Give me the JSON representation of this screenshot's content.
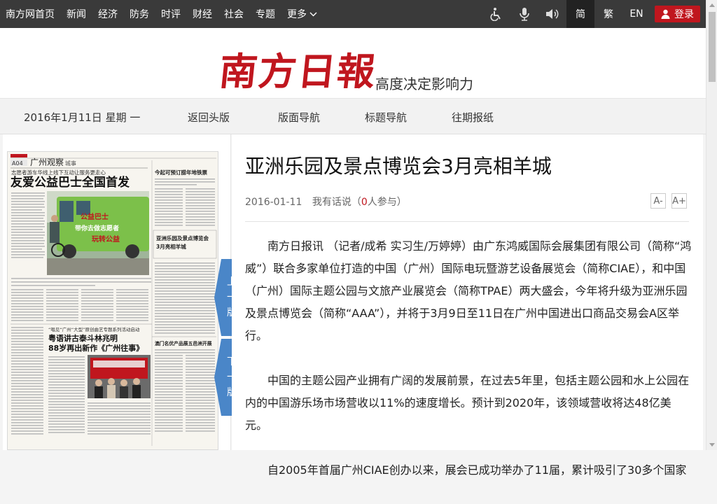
{
  "topnav": {
    "items": [
      "南方网首页",
      "新闻",
      "经济",
      "防务",
      "时评",
      "财经",
      "社会",
      "专题"
    ],
    "more": "更多",
    "langs": [
      "简",
      "繁",
      "EN"
    ],
    "login": "登录",
    "icons": [
      "accessibility-icon",
      "microphone-icon",
      "speaker-icon"
    ]
  },
  "masthead": {
    "logo_text": "南方日報",
    "slogan": "高度决定影响力",
    "brand_color": "#c0161e"
  },
  "subnav": {
    "date": "2016年1月11日 星期 一",
    "links": [
      "返回头版",
      "版面导航",
      "标题导航",
      "往期报纸"
    ]
  },
  "thumb": {
    "prev_label": [
      "上",
      "一",
      "版"
    ],
    "next_label": [
      "下",
      "一",
      "版"
    ],
    "page_no": "A04",
    "section": "广州观察",
    "section_sub": "城事",
    "kicker1": "志愿者游车华线上线下互动让服务更走心",
    "headline1": "友爱公益巴士全国首发",
    "headline2_top": "亚洲乐园及景点博览会",
    "headline2_bottom": "3月亮相羊城",
    "side_head": "今起可预订腊年地铁票",
    "kicker3": "“唱见“广州“大型”原创曲艺专题系列活动启动",
    "headline3a": "粤语讲古泰斗林兆明",
    "headline3b": "88岁再出新作《广州往事》",
    "side_head2": "澳门名优产品展五邑洲开展",
    "bus_text": [
      "公益巴士",
      "带你去做志愿者",
      "玩转公益"
    ],
    "accent_color": "#4a86c8"
  },
  "article": {
    "title": "亚洲乐园及景点博览会3月亮相羊城",
    "date": "2016-01-11",
    "comment_prefix": "我有话说（",
    "comment_count": "0",
    "comment_suffix": "人参与）",
    "font_minus": "A-",
    "font_plus": "A+",
    "paragraphs": [
      "南方日报讯 （记者/成希 实习生/万婷婷）由广东鸿威国际会展集团有限公司（简称“鸿威”）联合多家单位打造的中国（广州）国际电玩暨游艺设备展览会（简称CIAE），和中国（广州）国际主题公园与文旅产业展览会（简称TPAE）两大盛会，今年将升级为亚洲乐园及景点博览会（简称“AAA”），并将于3月9日至11日在广州中国进出口商品交易会A区举行。",
      "中国的主题公园产业拥有广阔的发展前景，在过去5年里，包括主题公园和水上公园在内的中国游乐场市场营收以11%的速度增长。预计到2020年，该领域营收将达48亿美元。",
      "自2005年首届广州CIAE创办以来，展会已成功举办了11届，累计吸引了30多个国家"
    ]
  }
}
